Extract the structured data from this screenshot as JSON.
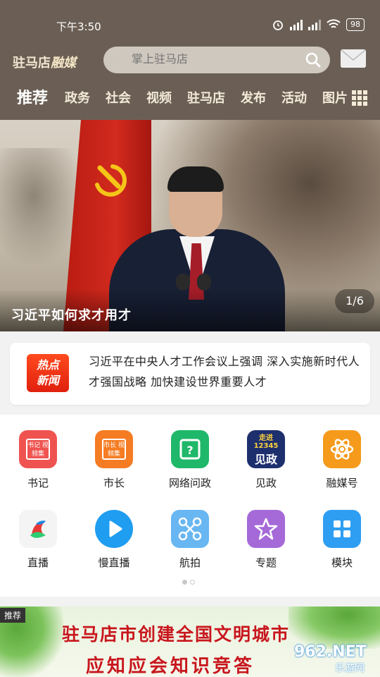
{
  "status_bar": {
    "time": "下午3:50",
    "battery": "98"
  },
  "header": {
    "brand_text": "驻马店",
    "brand_script": "融媒",
    "search_placeholder": "掌上驻马店",
    "tabs": [
      {
        "label": "推荐",
        "active": true
      },
      {
        "label": "政务"
      },
      {
        "label": "社会"
      },
      {
        "label": "视频"
      },
      {
        "label": "驻马店"
      },
      {
        "label": "发布"
      },
      {
        "label": "活动"
      },
      {
        "label": "图片"
      }
    ]
  },
  "banner": {
    "caption": "习近平如何求才用才",
    "pager": "1/6"
  },
  "hot_news": {
    "badge_line1": "热点",
    "badge_line2": "新闻",
    "text": "习近平在中央人才工作会议上强调 深入实施新时代人才强国战略 加快建设世界重要人才"
  },
  "grid_items": [
    {
      "label": "书记",
      "icon": "secretary-video-icon",
      "color": "#ef5350"
    },
    {
      "label": "市长",
      "icon": "mayor-video-icon",
      "color": "#f57c23"
    },
    {
      "label": "网络问政",
      "icon": "inquiry-icon",
      "color": "#1fb86a"
    },
    {
      "label": "见政",
      "icon": "jianzheng-icon",
      "color": "#1e2f6e"
    },
    {
      "label": "融媒号",
      "icon": "atom-icon",
      "color": "#f59a1b"
    },
    {
      "label": "直播",
      "icon": "live-icon",
      "color": "#f4f4f4"
    },
    {
      "label": "慢直播",
      "icon": "slow-live-icon",
      "color": "#1f9df0"
    },
    {
      "label": "航拍",
      "icon": "drone-icon",
      "color": "#68b6f2"
    },
    {
      "label": "专题",
      "icon": "star-icon",
      "color": "#a56ad8"
    },
    {
      "label": "模块",
      "icon": "modules-icon",
      "color": "#2e9ef2"
    }
  ],
  "icon_texts": {
    "secretary": "书记 视频集",
    "mayor": "市长 视频集",
    "jianzheng_top": "走进12345",
    "jianzheng_bottom": "见政"
  },
  "promo": {
    "tag": "推荐",
    "line1": "驻马店市创建全国文明城市",
    "line2": "应知应会知识竞答"
  },
  "watermark": {
    "top": "962.NET",
    "bottom": "乐游网"
  }
}
